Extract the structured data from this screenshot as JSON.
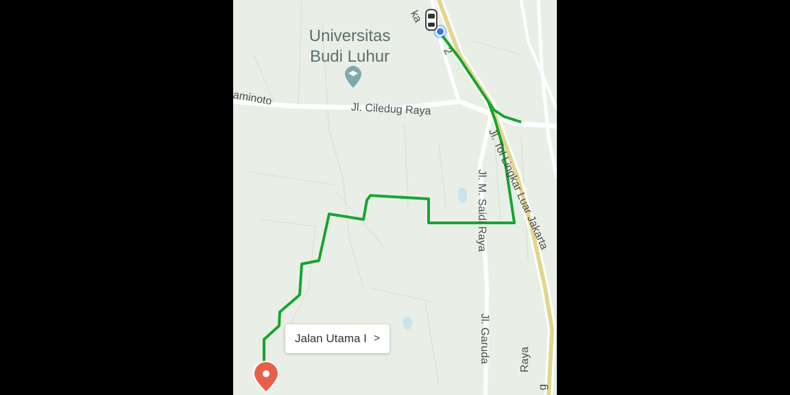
{
  "map": {
    "poi": {
      "name_line1": "Universitas",
      "name_line2": "Budi Luhur",
      "icon": "graduation-cap-icon"
    },
    "roads": {
      "ciledug_west": "aminoto",
      "ciledug": "Jl. Ciledug Raya",
      "toll": "Jl. Tol Lingkar Luar Jakarta",
      "north_road": "ka",
      "north_road_tail": "2",
      "saidi": "Jl. M. Saidi Raya",
      "garuda": "Jl. Garuda",
      "raya_south": "Raya",
      "right_edge": "g"
    },
    "destination_callout": {
      "label": "Jalan Utama I",
      "chevron": ">"
    },
    "markers": {
      "origin": "car-icon",
      "destination": "pin-icon"
    },
    "colors": {
      "route": "#16a52f",
      "pin": "#e8604a",
      "land": "#e9efe6",
      "road": "#ffffff",
      "toll_road": "#e2d68e",
      "location_dot": "#2f7bf6"
    }
  }
}
